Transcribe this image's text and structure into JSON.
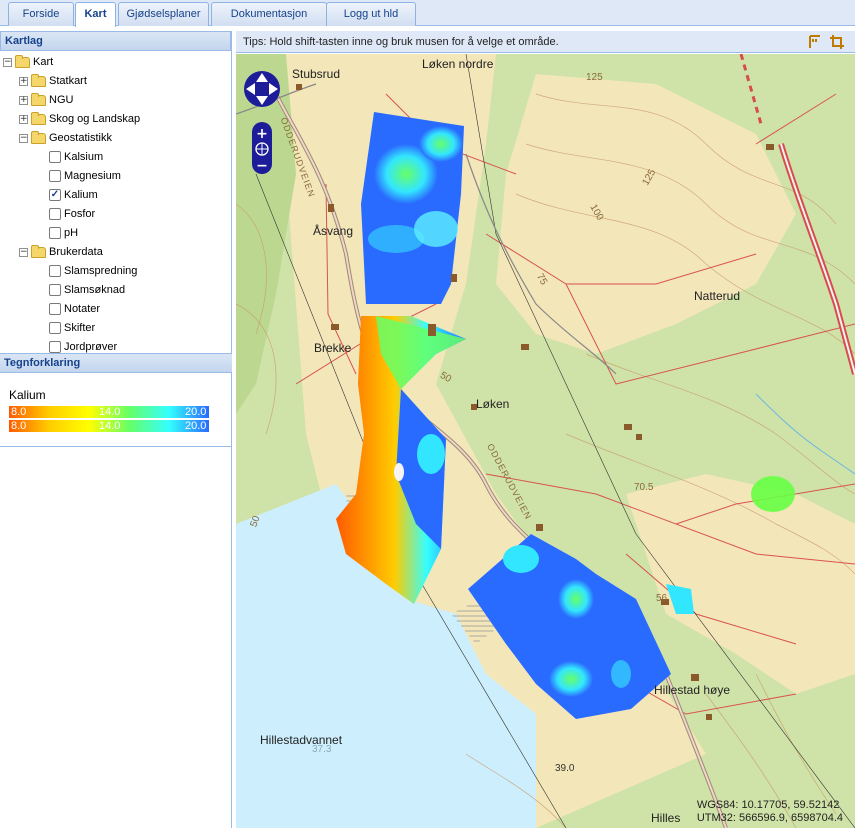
{
  "tabs": [
    {
      "label": "Forside",
      "active": false
    },
    {
      "label": "Kart",
      "active": true
    },
    {
      "label": "Gjødselsplaner",
      "active": false
    },
    {
      "label": "Dokumentasjon",
      "active": false
    },
    {
      "label": "Logg ut hld",
      "active": false
    }
  ],
  "layers_panel": {
    "title": "Kartlag",
    "root": "Kart",
    "groups": {
      "statkart": "Statkart",
      "ngu": "NGU",
      "skog": "Skog og Landskap",
      "geostat": "Geostatistikk",
      "brukerdata": "Brukerdata"
    },
    "geostat_items": [
      {
        "label": "Kalsium",
        "checked": false
      },
      {
        "label": "Magnesium",
        "checked": false
      },
      {
        "label": "Kalium",
        "checked": true
      },
      {
        "label": "Fosfor",
        "checked": false
      },
      {
        "label": "pH",
        "checked": false
      }
    ],
    "brukerdata_items": [
      {
        "label": "Slamspredning",
        "checked": false
      },
      {
        "label": "Slamsøknad",
        "checked": false
      },
      {
        "label": "Notater",
        "checked": false
      },
      {
        "label": "Skifter",
        "checked": false
      },
      {
        "label": "Jordprøver",
        "checked": false
      }
    ]
  },
  "legend": {
    "title": "Tegnforklaring",
    "layer": "Kalium",
    "row1": {
      "min": "8.0",
      "mid": "14.0",
      "max": "20.0"
    },
    "row2": {
      "min": "8.0",
      "mid": "14.0",
      "max": "20.0"
    },
    "colors": [
      "#ff5a00",
      "#ffcc00",
      "#ffff00",
      "#66ff66",
      "#33ffff",
      "#2a6bff"
    ]
  },
  "map": {
    "tips": "Tips: Hold shift-tasten inne og bruk musen for å velge et område.",
    "place_labels": {
      "stubsrud": "Stubsrud",
      "loken_nordre": "Løken nordre",
      "asvang": "Åsvang",
      "natterud": "Natterud",
      "brekke": "Brekke",
      "loken": "Løken",
      "hillestad_hoye": "Hillestad høye",
      "hillestadvannet": "Hillestadvannet",
      "hilles": "Hilles"
    },
    "road_name_1": "ODDERUDVEIEN",
    "road_name_2": "ODDERUDVEIEN",
    "contours": [
      "125",
      "125",
      "100",
      "75",
      "50",
      "70.5",
      "50",
      "56",
      "37.3",
      "39.0"
    ],
    "wgs84": "WGS84: 10.17705, 59.52142",
    "utm32": "UTM32: 566596.9, 6598704.4"
  },
  "icons": {
    "pan": "pan-arrows-icon",
    "zoom_in": "zoom-in-icon",
    "zoom_world": "globe-icon",
    "zoom_out": "zoom-out-icon",
    "tool1": "select-tool-icon",
    "tool2": "crop-tool-icon"
  }
}
